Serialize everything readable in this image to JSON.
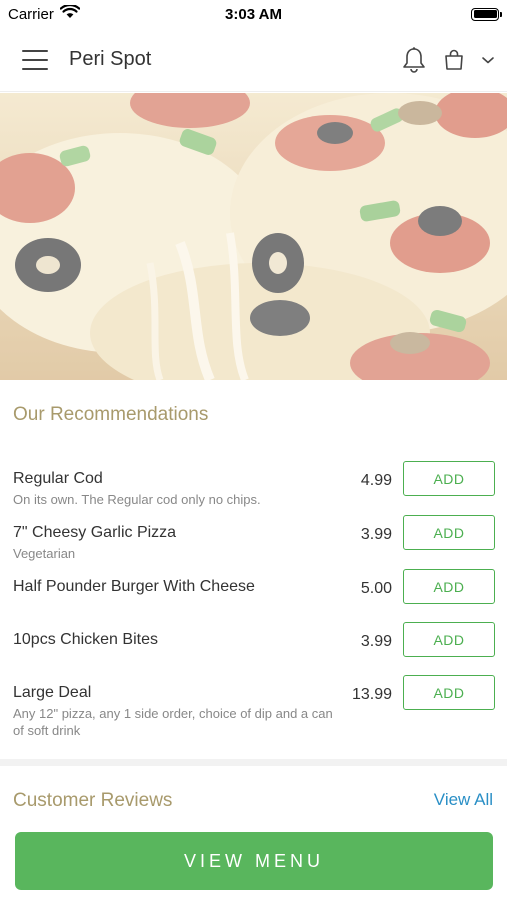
{
  "status_bar": {
    "carrier": "Carrier",
    "time": "3:03 AM"
  },
  "header": {
    "title": "Peri Spot",
    "icons": [
      "menu-icon",
      "bell-icon",
      "shopping-bag-icon",
      "chevron-down-icon"
    ]
  },
  "hero": {
    "image_subject": "pizza"
  },
  "recommendations": {
    "title": "Our Recommendations",
    "add_label": "ADD",
    "items": [
      {
        "name": "Regular Cod",
        "description": "On its own. The Regular cod only no chips.",
        "price": "4.99"
      },
      {
        "name": "7\" Cheesy Garlic Pizza",
        "description": "Vegetarian",
        "price": "3.99"
      },
      {
        "name": "Half Pounder Burger With Cheese",
        "description": "",
        "price": "5.00"
      },
      {
        "name": "10pcs Chicken Bites",
        "description": "",
        "price": "3.99"
      },
      {
        "name": "Large Deal",
        "description": "Any 12\" pizza, any 1 side order, choice of dip and a can of soft drink",
        "price": "13.99"
      }
    ]
  },
  "reviews": {
    "title": "Customer Reviews",
    "view_all_label": "View All"
  },
  "footer": {
    "view_menu_label": "VIEW MENU"
  },
  "colors": {
    "accent_green": "#59b65d",
    "section_title": "#a89a6c",
    "link_blue": "#2a8fc6"
  }
}
